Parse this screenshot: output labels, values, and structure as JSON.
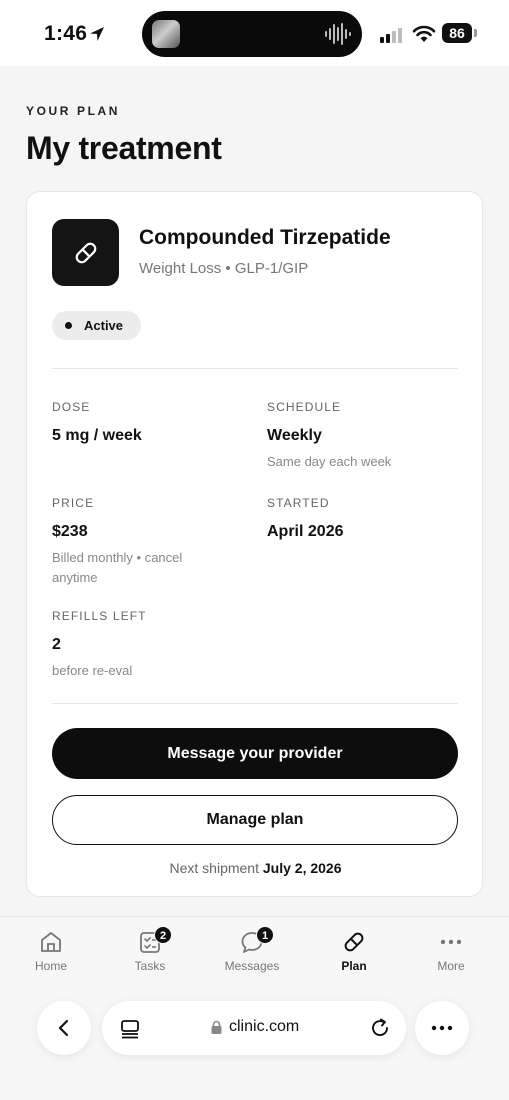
{
  "status_bar": {
    "time": "1:46",
    "battery": "86"
  },
  "header": {
    "eyebrow": "YOUR PLAN",
    "title": "My treatment"
  },
  "treatment": {
    "name": "Compounded Tirzepatide",
    "subtitle": "Weight Loss • GLP-1/GIP",
    "status": "Active",
    "icon": "pill-icon",
    "fields": {
      "dose": {
        "label": "DOSE",
        "value": "5 mg / week"
      },
      "schedule": {
        "label": "SCHEDULE",
        "value": "Weekly",
        "note": "Same day each week"
      },
      "price": {
        "label": "PRICE",
        "value": "$238",
        "note": "Billed monthly • cancel anytime"
      },
      "started": {
        "label": "STARTED",
        "value": "April 2026"
      },
      "refills": {
        "label": "REFILLS LEFT",
        "value": "2",
        "note": "before re-eval"
      }
    },
    "primary_button": "Message your provider",
    "secondary_button": "Manage plan",
    "shipment_prefix": "Next shipment",
    "shipment_date": "July 2, 2026"
  },
  "tabbar": {
    "items": [
      {
        "label": "Home",
        "icon": "home-icon"
      },
      {
        "label": "Tasks",
        "icon": "tasks-icon",
        "badge": "2"
      },
      {
        "label": "Messages",
        "icon": "messages-icon",
        "badge": "1"
      },
      {
        "label": "Plan",
        "icon": "pill-icon",
        "active": true
      },
      {
        "label": "More",
        "icon": "more-dots-icon"
      }
    ]
  },
  "browser": {
    "url": "clinic.com"
  }
}
